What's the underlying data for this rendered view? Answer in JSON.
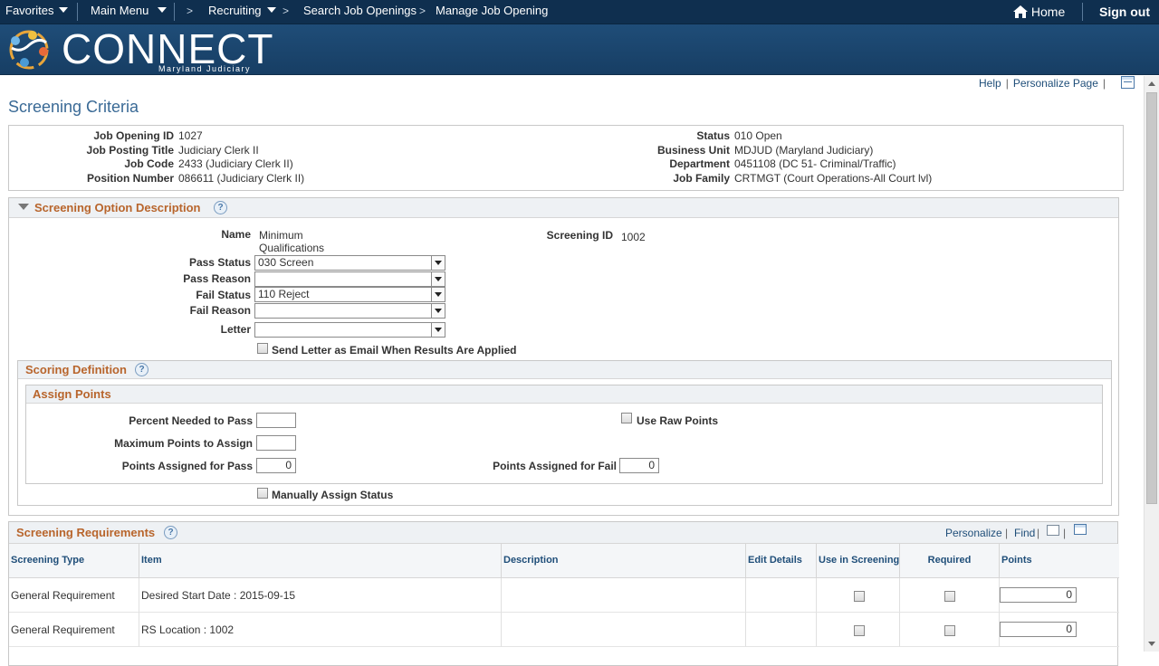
{
  "nav": {
    "favorites": "Favorites",
    "main_menu": "Main Menu",
    "recruiting": "Recruiting",
    "search_job_openings": "Search Job Openings",
    "manage_job_opening": "Manage Job Opening",
    "home": "Home",
    "sign_out": "Sign out"
  },
  "banner": {
    "logo": "CONNECT",
    "subtitle": "Maryland Judiciary"
  },
  "page_links": {
    "help": "Help",
    "personalize_page": "Personalize Page"
  },
  "page_title": "Screening Criteria",
  "header": {
    "job_opening_id_label": "Job Opening ID",
    "job_opening_id": "1027",
    "job_posting_title_label": "Job Posting Title",
    "job_posting_title": "Judiciary Clerk II",
    "job_code_label": "Job Code",
    "job_code": "2433 (Judiciary Clerk II)",
    "position_number_label": "Position Number",
    "position_number": "086611 (Judiciary Clerk II)",
    "status_label": "Status",
    "status": "010 Open",
    "business_unit_label": "Business Unit",
    "business_unit": "MDJUD (Maryland Judiciary)",
    "department_label": "Department",
    "department": "0451108 (DC 51- Criminal/Traffic)",
    "job_family_label": "Job Family",
    "job_family": "CRTMGT (Court Operations-All Court lvl)"
  },
  "screening_option": {
    "title": "Screening Option Description",
    "name_label": "Name",
    "name_line1": "Minimum",
    "name_line2": "Qualifications",
    "screening_id_label": "Screening ID",
    "screening_id": "1002",
    "pass_status_label": "Pass Status",
    "pass_status": "030 Screen",
    "pass_reason_label": "Pass Reason",
    "pass_reason": "",
    "fail_status_label": "Fail Status",
    "fail_status": "110 Reject",
    "fail_reason_label": "Fail Reason",
    "fail_reason": "",
    "letter_label": "Letter",
    "letter": "",
    "send_letter_label": "Send Letter as Email When Results Are Applied"
  },
  "scoring": {
    "title": "Scoring Definition",
    "assign_points_title": "Assign Points",
    "percent_needed_label": "Percent Needed to Pass",
    "percent_needed": "",
    "use_raw_points_label": "Use Raw Points",
    "max_points_label": "Maximum Points to Assign",
    "max_points": "",
    "points_pass_label": "Points Assigned for Pass",
    "points_pass": "0",
    "points_fail_label": "Points Assigned for Fail",
    "points_fail": "0",
    "manually_assign_label": "Manually Assign Status"
  },
  "requirements": {
    "title": "Screening Requirements",
    "personalize": "Personalize",
    "find": "Find",
    "columns": [
      "Screening Type",
      "Item",
      "Description",
      "Edit Details",
      "Use in Screening",
      "Required",
      "Points"
    ],
    "rows": [
      {
        "type": "General Requirement",
        "item": "Desired Start Date : 2015-09-15",
        "description": "",
        "points": "0"
      },
      {
        "type": "General Requirement",
        "item": "RS Location : 1002",
        "description": "",
        "points": "0"
      }
    ]
  },
  "help_glyph": "?"
}
